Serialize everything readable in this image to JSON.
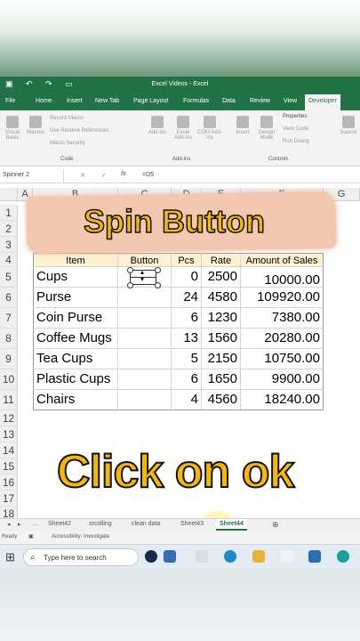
{
  "window": {
    "title": "Excel Videos - Excel"
  },
  "ribbon_tabs": [
    "File",
    "Home",
    "Insert",
    "New Tab",
    "Page Layout",
    "Formulas",
    "Data",
    "Review",
    "View",
    "Developer"
  ],
  "active_tab": "Developer",
  "ribbon": {
    "visual_basic": "Visual Basic",
    "macros": "Macros",
    "record_macro": "Record Macro",
    "relative_refs": "Use Relative References",
    "macro_security": "Macro Security",
    "addins": "Add-ins",
    "excel_addins": "Excel Add-ins",
    "com_addins": "COM Add-ins",
    "insert": "Insert",
    "design_mode": "Design Mode",
    "properties": "Properties",
    "view_code": "View Code",
    "run_dialog": "Run Dialog",
    "source": "Source",
    "group_code": "Code",
    "group_addins": "Add-ins",
    "group_controls": "Controls"
  },
  "formula_bar": {
    "name_box": "Spinner 2",
    "fx": "fx",
    "formula": "=D5"
  },
  "columns": [
    "A",
    "B",
    "C",
    "D",
    "E",
    "F",
    "G"
  ],
  "rows": [
    "1",
    "2",
    "3",
    "4",
    "5",
    "6",
    "7",
    "8",
    "9",
    "10",
    "11",
    "12",
    "13",
    "14",
    "15",
    "16",
    "17",
    "18"
  ],
  "table": {
    "headers": [
      "Item",
      "Button",
      "Pcs",
      "Rate",
      "Amount of Sales"
    ],
    "rows": [
      {
        "item": "Cups",
        "pcs": "0",
        "rate": "2500",
        "amount": "10000.00"
      },
      {
        "item": "Purse",
        "pcs": "24",
        "rate": "4580",
        "amount": "109920.00"
      },
      {
        "item": "Coin Purse",
        "pcs": "6",
        "rate": "1230",
        "amount": "7380.00"
      },
      {
        "item": "Coffee Mugs",
        "pcs": "13",
        "rate": "1560",
        "amount": "20280.00"
      },
      {
        "item": "Tea Cups",
        "pcs": "5",
        "rate": "2150",
        "amount": "10750.00"
      },
      {
        "item": "Plastic Cups",
        "pcs": "6",
        "rate": "1650",
        "amount": "9900.00"
      },
      {
        "item": "Chairs",
        "pcs": "4",
        "rate": "4560",
        "amount": "18240.00"
      }
    ]
  },
  "overlays": {
    "spin_title": "Spin Button",
    "instruction": "Click on ok"
  },
  "sheet_tabs": [
    "Sheet42",
    "srcolling",
    "clean data",
    "Sheet43",
    "Sheet44"
  ],
  "active_sheet": "Sheet44",
  "status": {
    "ready": "Ready",
    "accessibility": "Accessibility: Investigate"
  },
  "taskbar": {
    "search_placeholder": "Type here to search"
  },
  "colors": {
    "excel_green": "#217346",
    "header_fill": "#fdf1d1",
    "overlay_text": "#f5b800"
  }
}
